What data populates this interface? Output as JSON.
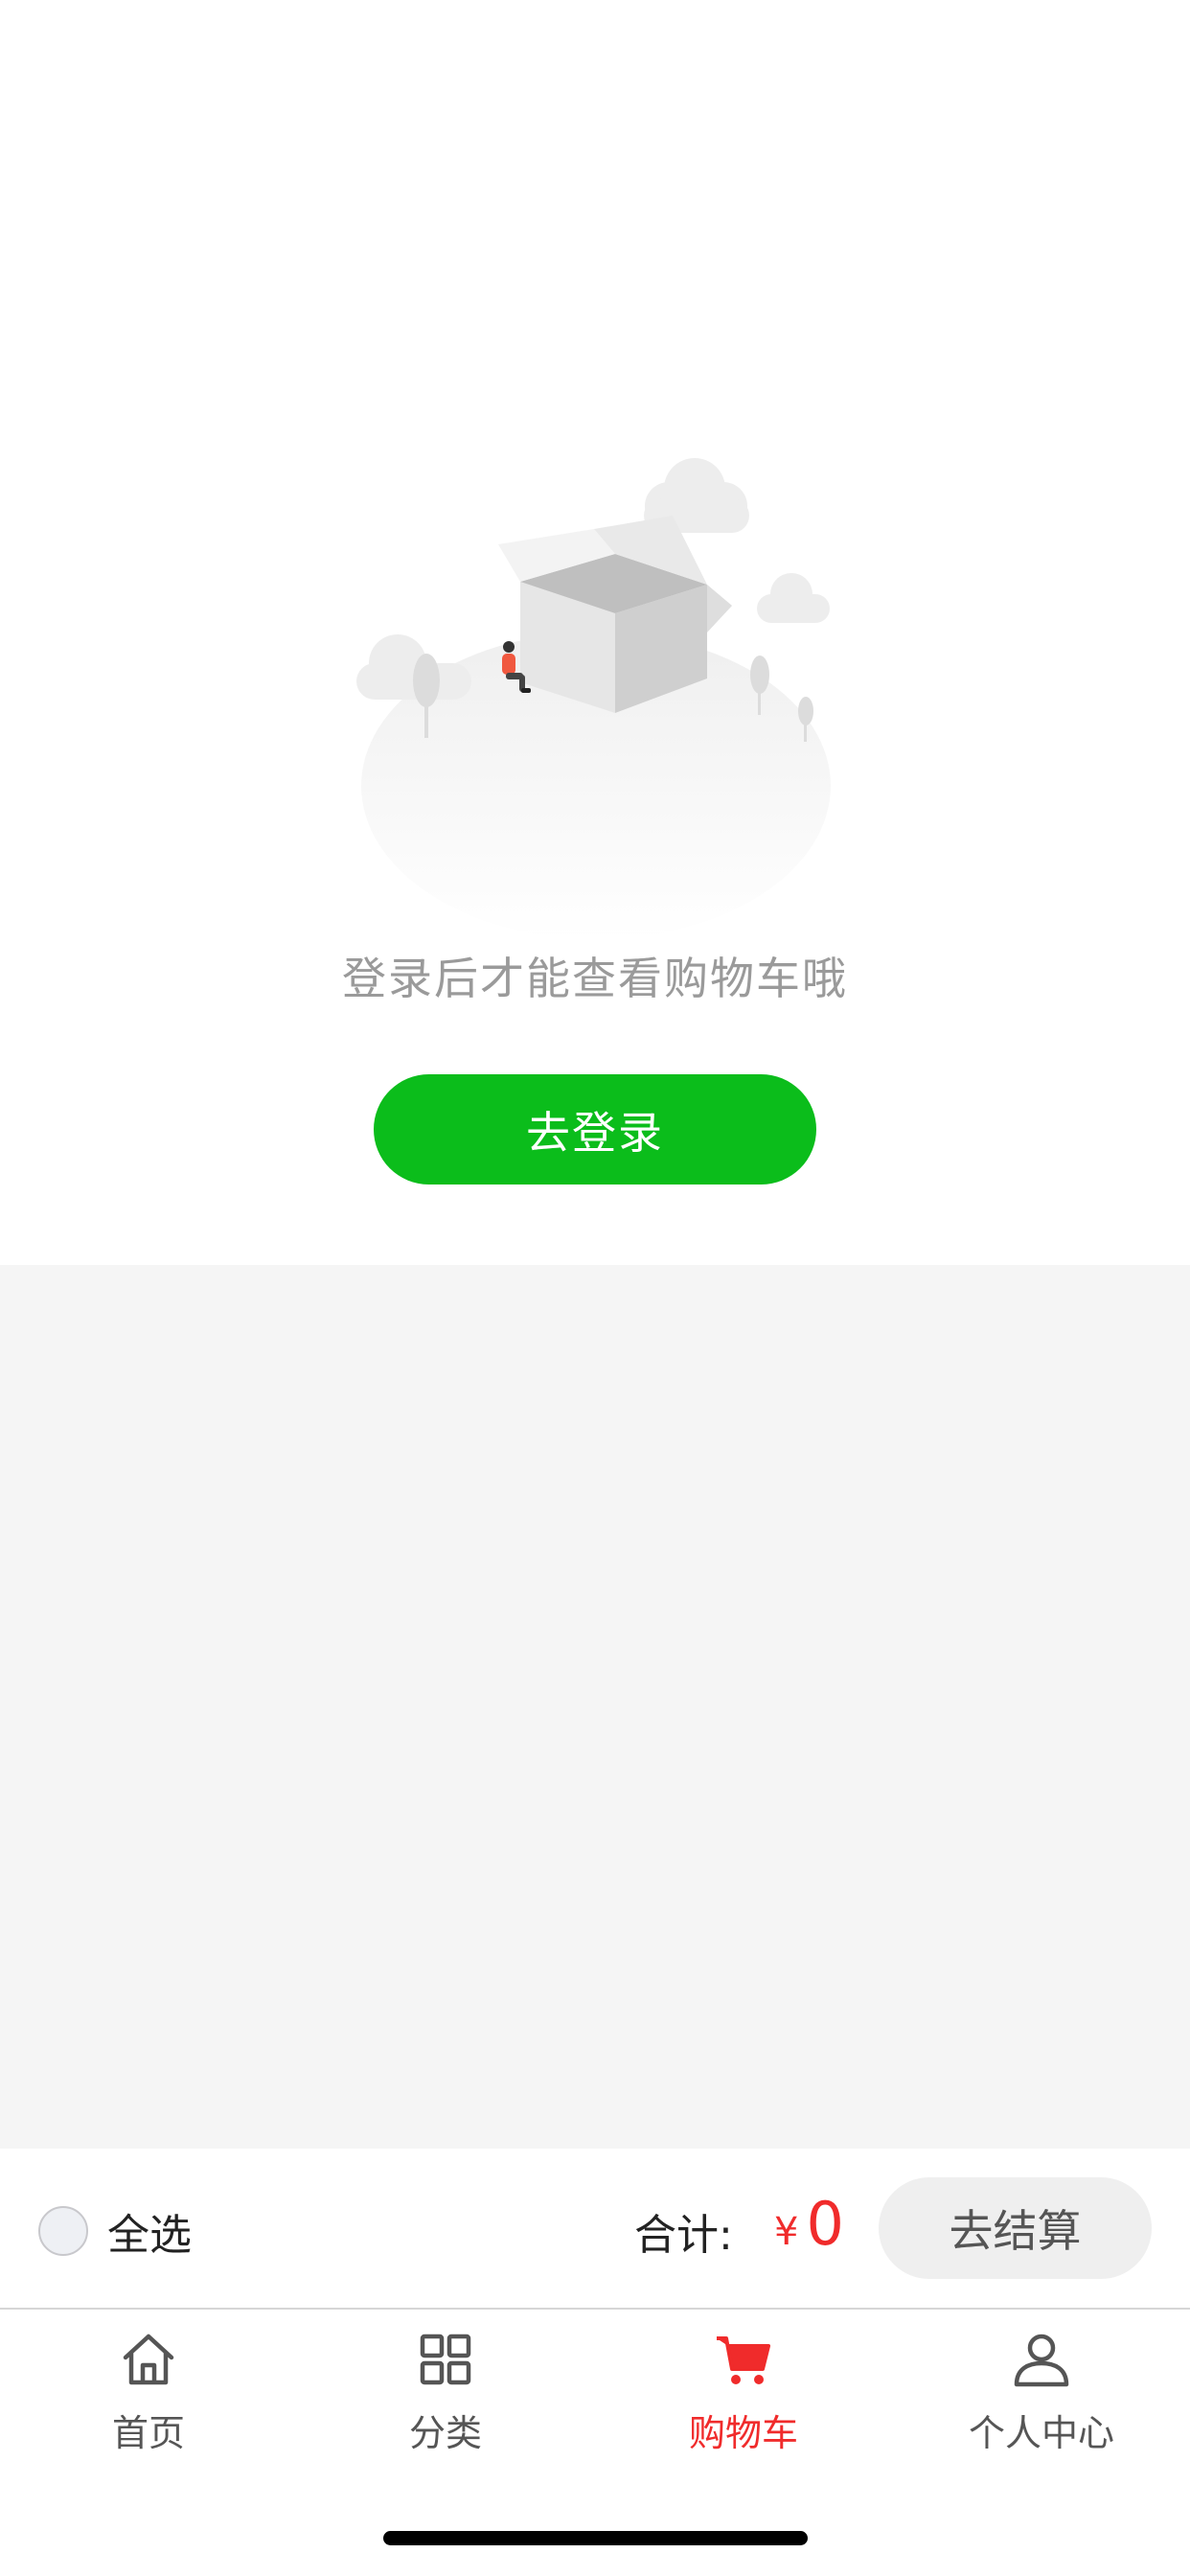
{
  "empty_state": {
    "message": "登录后才能查看购物车哦",
    "login_button_label": "去登录"
  },
  "cart_bar": {
    "select_all_label": "全选",
    "total_label": "合计:",
    "currency_symbol": "¥",
    "total_value": "0",
    "checkout_label": "去结算"
  },
  "tabs": [
    {
      "label": "首页",
      "icon": "home-icon",
      "active": false
    },
    {
      "label": "分类",
      "icon": "grid-icon",
      "active": false
    },
    {
      "label": "购物车",
      "icon": "cart-icon",
      "active": true
    },
    {
      "label": "个人中心",
      "icon": "user-icon",
      "active": false
    }
  ],
  "colors": {
    "accent_green": "#0bbd1b",
    "price_red": "#f02b2b",
    "background_gray": "#f5f5f5"
  }
}
